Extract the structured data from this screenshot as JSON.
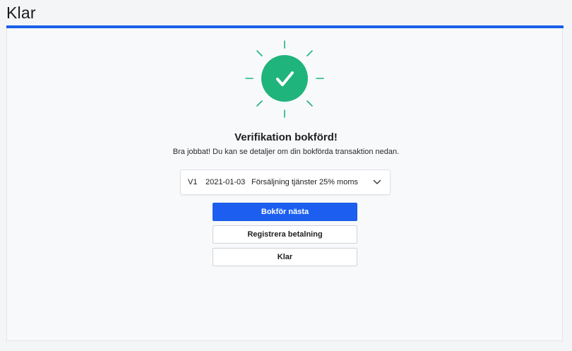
{
  "header": {
    "title": "Klar"
  },
  "colors": {
    "accent": "#1a5fe8",
    "success": "#1fb47b",
    "primary_button": "#1c5ff0"
  },
  "success": {
    "icon": "check-icon",
    "heading": "Verifikation bokförd!",
    "message": "Bra jobbat! Du kan se detaljer om din bokförda transaktion nedan."
  },
  "verification": {
    "id": "V1",
    "date": "2021-01-03",
    "description": "Försäljning tjänster 25% moms",
    "toggle_icon": "chevron-down-icon"
  },
  "actions": {
    "book_next": "Bokför nästa",
    "register_payment": "Registrera betalning",
    "done": "Klar"
  }
}
